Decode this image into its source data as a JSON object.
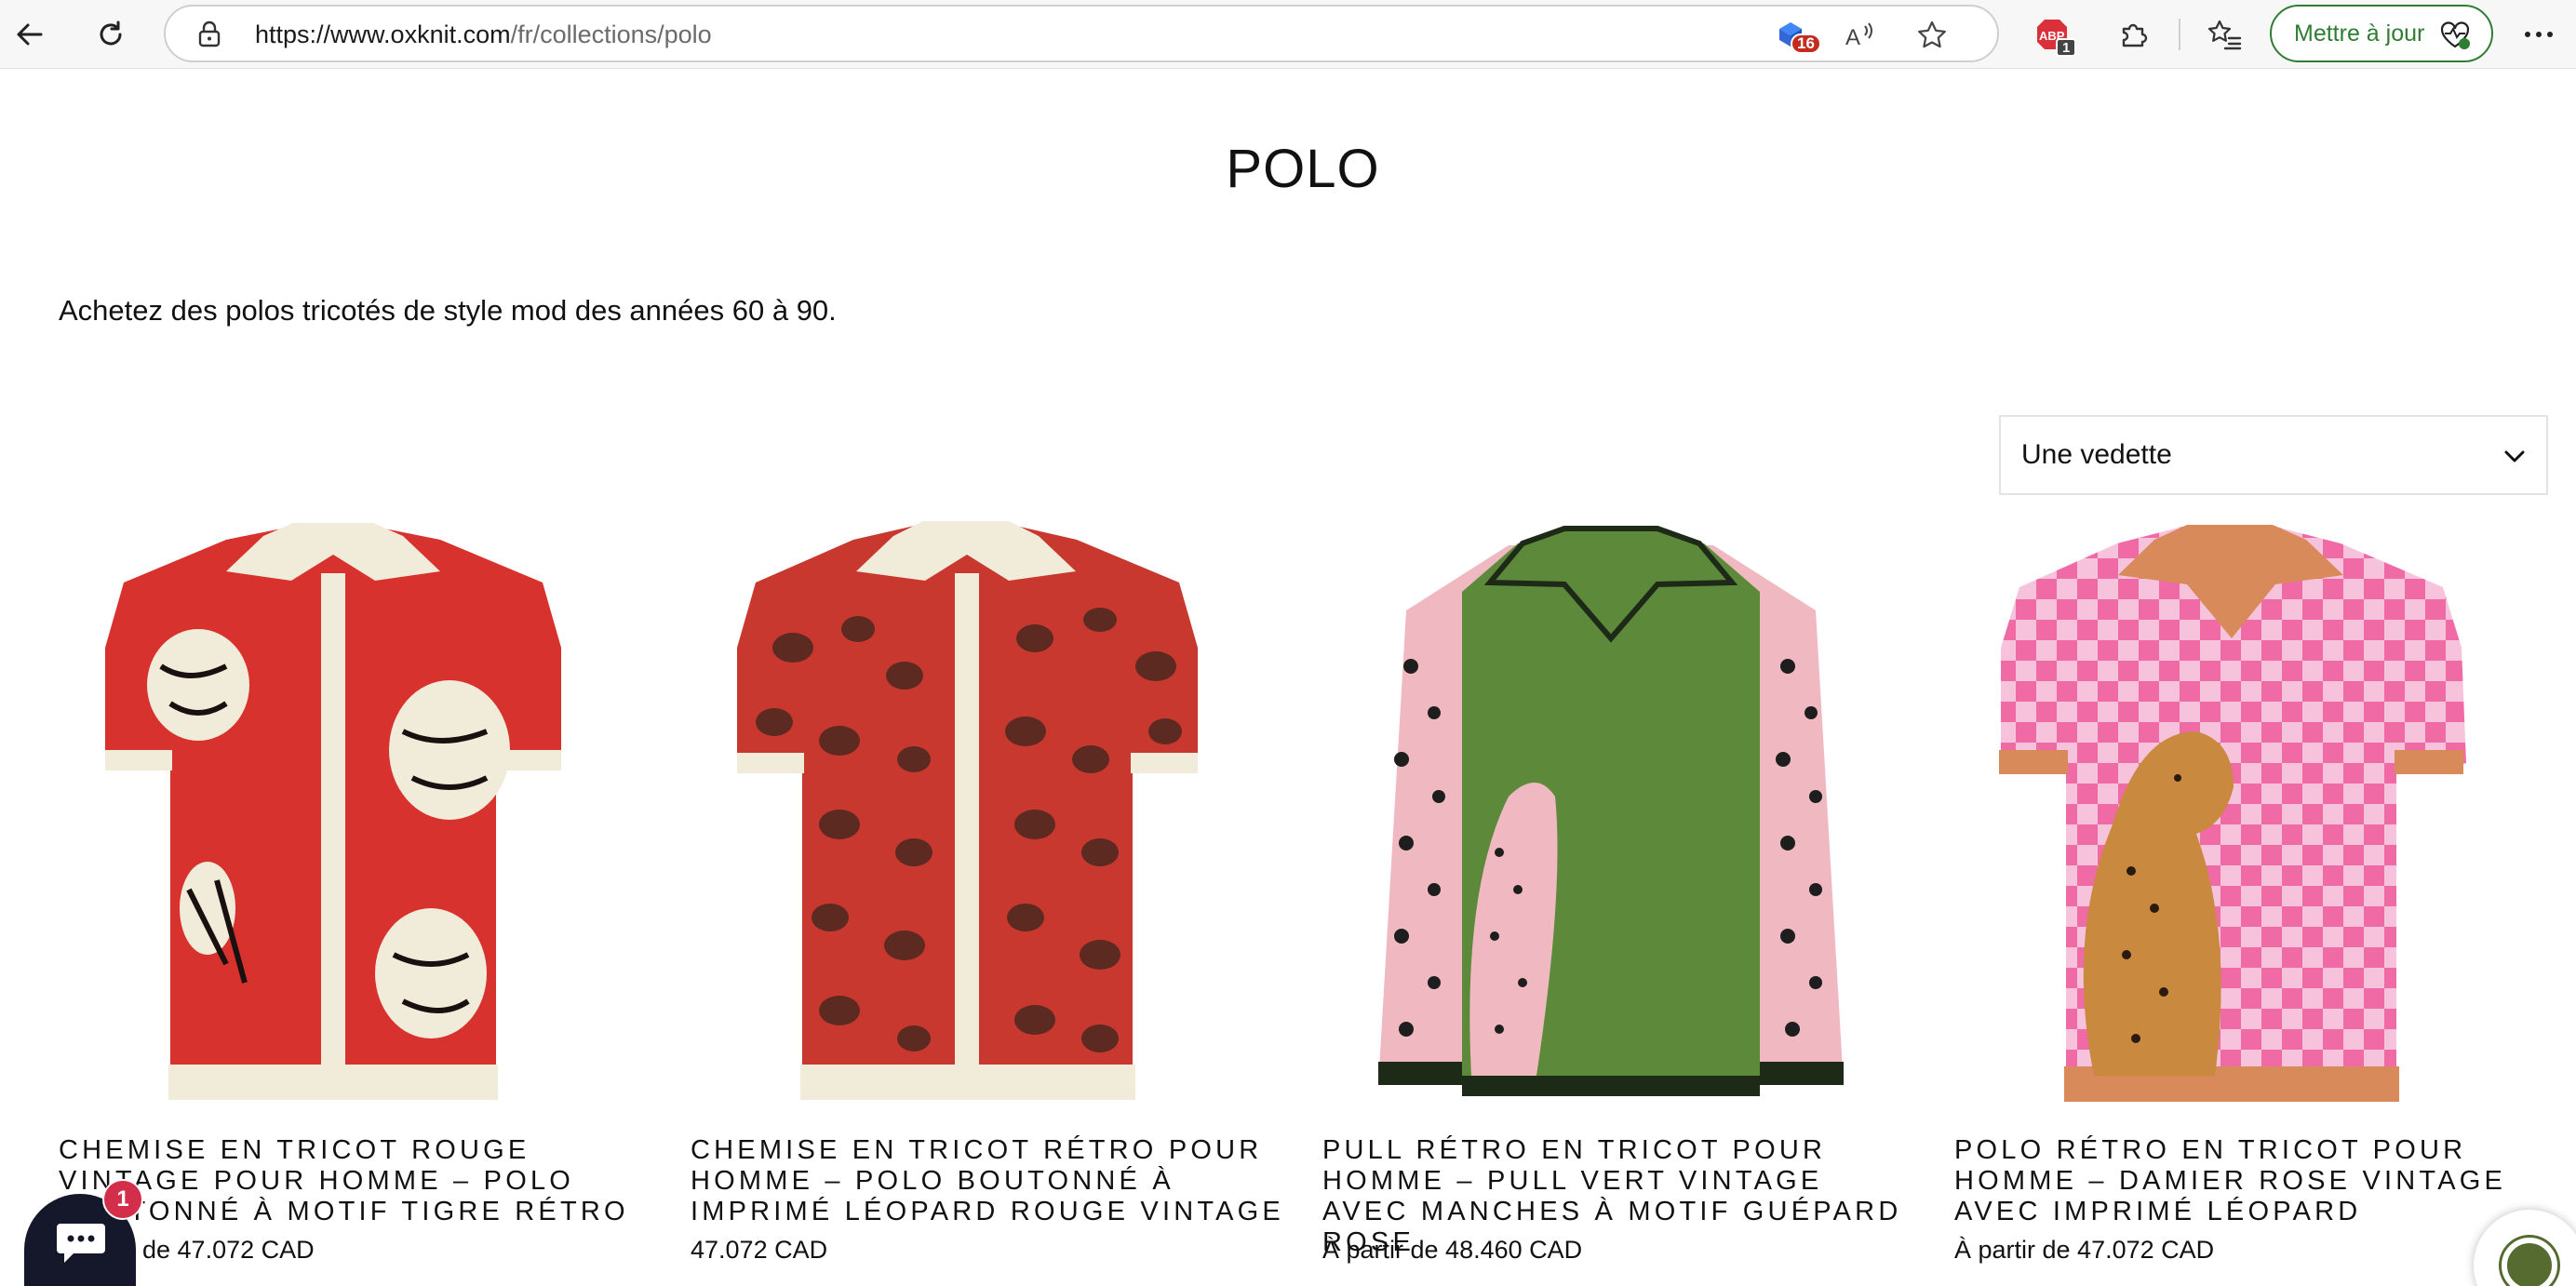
{
  "browser": {
    "url_host": "https://www.oxknit.com",
    "url_path": "/fr/collections/polo",
    "extension_badge_count": "16",
    "adblock_label": "ABP",
    "adblock_badge_count": "1",
    "update_button_label": "Mettre à jour",
    "icons": [
      "back-arrow-icon",
      "refresh-icon",
      "lock-icon",
      "read-aloud-icon",
      "favorite-star-icon",
      "extensions-puzzle-icon",
      "favorites-list-icon",
      "heart-pulse-icon",
      "more-menu-icon"
    ]
  },
  "page": {
    "title": "POLO",
    "description": "Achetez des polos tricotés de style mod des années 60 à 90.",
    "sort": {
      "selected": "Une vedette"
    }
  },
  "products": [
    {
      "name": "Chemise en tricot rouge vintage pour homme – Polo boutonné à motif tigre rétro",
      "price": "À partir de 47.072 CAD",
      "visible_price": "de 47.072 CAD",
      "colors": {
        "body": "#d8322e",
        "trim": "#f1ebd9",
        "motif": "#f1ebd9"
      }
    },
    {
      "name": "Chemise en tricot rétro pour homme – Polo boutonné à imprimé léopard rouge vintage",
      "price": "47.072 CAD",
      "colors": {
        "body": "#c8382f",
        "trim": "#f1ebd9",
        "motif": "#5c2a20"
      }
    },
    {
      "name": "Pull rétro en tricot pour homme – Pull vert vintage avec manches à motif guépard rose",
      "price": "À partir de 48.460 CAD",
      "colors": {
        "body": "#5c8a3a",
        "trim": "#1e2a18",
        "sleeve": "#f0b8c0"
      }
    },
    {
      "name": "Polo rétro en tricot pour homme – Damier rose vintage avec imprimé léopard",
      "price": "À partir de 47.072 CAD",
      "colors": {
        "body": "#f06aa5",
        "trim": "#d88a5a",
        "check": "#f7c3dc"
      }
    }
  ],
  "chat": {
    "badge_count": "1"
  }
}
